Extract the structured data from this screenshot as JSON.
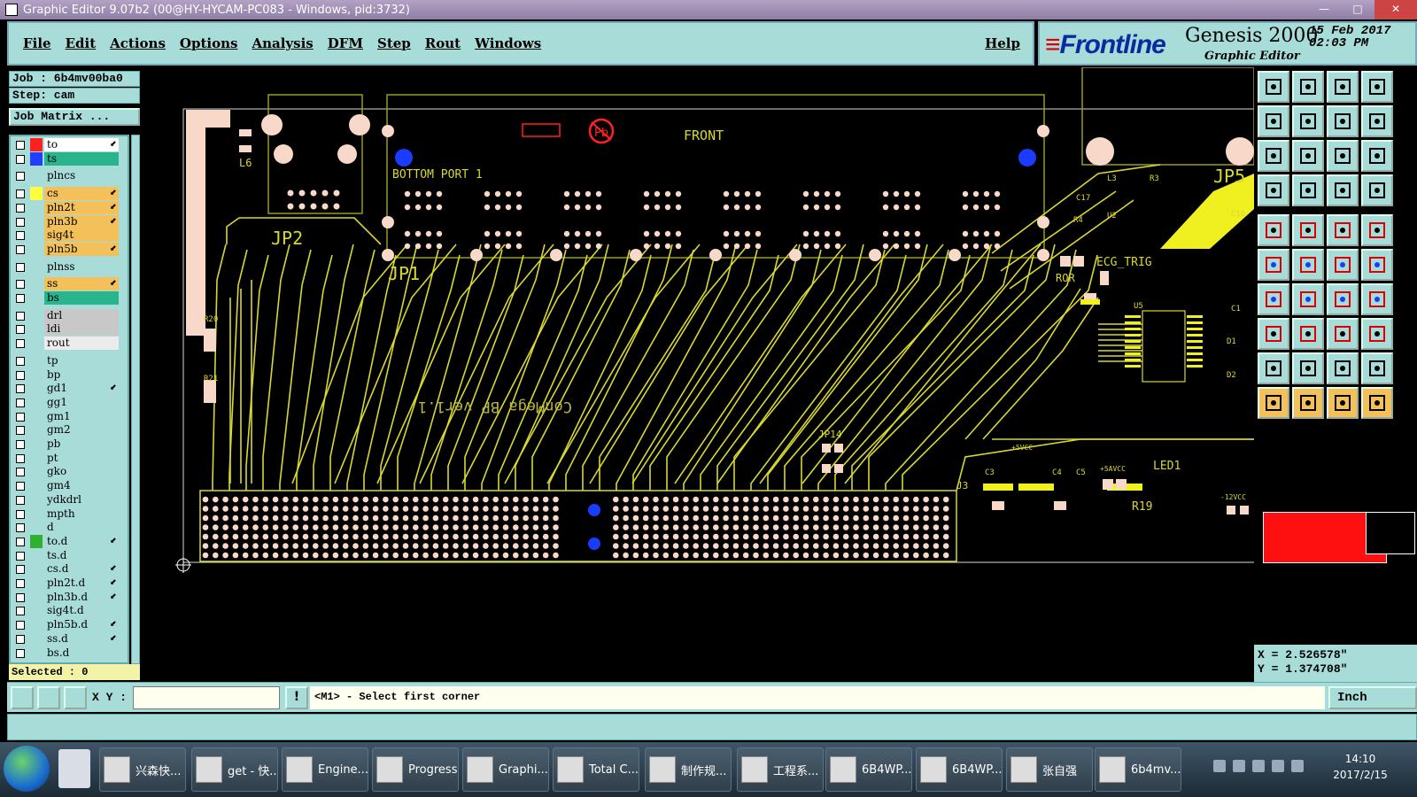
{
  "window": {
    "title": "Graphic Editor 9.07b2 (00@HY-HYCAM-PC083 - Windows, pid:3732)"
  },
  "menu": {
    "items": [
      "File",
      "Edit",
      "Actions",
      "Options",
      "Analysis",
      "DFM",
      "Step",
      "Rout",
      "Windows"
    ],
    "help": "Help"
  },
  "brand": {
    "logo": "Frontline",
    "product": "Genesis 2000",
    "subtitle": "Graphic Editor",
    "date": "15 Feb 2017",
    "time": "02:03 PM"
  },
  "job": {
    "job_label": "Job : 6b4mv00ba0",
    "step_label": "Step: cam",
    "matrix_label": "Job Matrix ..."
  },
  "layers": [
    {
      "name": "to",
      "color": "#ff2020",
      "bg": "#ffffff",
      "arrow": true
    },
    {
      "name": "ts",
      "color": "#2040ff",
      "bg": "#28b48c",
      "arrow": false
    },
    {
      "name": "plncs",
      "color": "",
      "bg": "#a8dcd8",
      "arrow": false
    },
    {
      "name": "cs",
      "color": "#ffff40",
      "bg": "#f3c05a",
      "arrow": true
    },
    {
      "name": "pln2t",
      "color": "",
      "bg": "#f3c05a",
      "arrow": true
    },
    {
      "name": "pln3b",
      "color": "",
      "bg": "#f3c05a",
      "arrow": true
    },
    {
      "name": "sig4t",
      "color": "",
      "bg": "#f3c05a",
      "arrow": false
    },
    {
      "name": "pln5b",
      "color": "",
      "bg": "#f3c05a",
      "arrow": true
    },
    {
      "name": "plnss",
      "color": "",
      "bg": "#a8dcd8",
      "arrow": false
    },
    {
      "name": "ss",
      "color": "",
      "bg": "#f3c05a",
      "arrow": true
    },
    {
      "name": "bs",
      "color": "",
      "bg": "#28b48c",
      "arrow": false
    },
    {
      "name": "drl",
      "color": "",
      "bg": "#c8c8c8",
      "arrow": false
    },
    {
      "name": "ldi",
      "color": "",
      "bg": "#c8c8c8",
      "arrow": false
    },
    {
      "name": "rout",
      "color": "",
      "bg": "#ececec",
      "arrow": false
    },
    {
      "name": "tp",
      "color": "",
      "bg": "#a8dcd8",
      "arrow": false
    },
    {
      "name": "bp",
      "color": "",
      "bg": "#a8dcd8",
      "arrow": false
    },
    {
      "name": "gd1",
      "color": "",
      "bg": "#a8dcd8",
      "arrow": true
    },
    {
      "name": "gg1",
      "color": "",
      "bg": "#a8dcd8",
      "arrow": false
    },
    {
      "name": "gm1",
      "color": "",
      "bg": "#a8dcd8",
      "arrow": false
    },
    {
      "name": "gm2",
      "color": "",
      "bg": "#a8dcd8",
      "arrow": false
    },
    {
      "name": "pb",
      "color": "",
      "bg": "#a8dcd8",
      "arrow": false
    },
    {
      "name": "pt",
      "color": "",
      "bg": "#a8dcd8",
      "arrow": false
    },
    {
      "name": "gko",
      "color": "",
      "bg": "#a8dcd8",
      "arrow": false
    },
    {
      "name": "gm4",
      "color": "",
      "bg": "#a8dcd8",
      "arrow": false
    },
    {
      "name": "ydkdrl",
      "color": "",
      "bg": "#a8dcd8",
      "arrow": false
    },
    {
      "name": "mpth",
      "color": "",
      "bg": "#a8dcd8",
      "arrow": false
    },
    {
      "name": "d",
      "color": "",
      "bg": "#a8dcd8",
      "arrow": false
    },
    {
      "name": "to.d",
      "color": "#30b030",
      "bg": "#a8dcd8",
      "arrow": true
    },
    {
      "name": "ts.d",
      "color": "",
      "bg": "#a8dcd8",
      "arrow": false
    },
    {
      "name": "cs.d",
      "color": "",
      "bg": "#a8dcd8",
      "arrow": true
    },
    {
      "name": "pln2t.d",
      "color": "",
      "bg": "#a8dcd8",
      "arrow": true
    },
    {
      "name": "pln3b.d",
      "color": "",
      "bg": "#a8dcd8",
      "arrow": true
    },
    {
      "name": "sig4t.d",
      "color": "",
      "bg": "#a8dcd8",
      "arrow": false
    },
    {
      "name": "pln5b.d",
      "color": "",
      "bg": "#a8dcd8",
      "arrow": true
    },
    {
      "name": "ss.d",
      "color": "",
      "bg": "#a8dcd8",
      "arrow": true
    },
    {
      "name": "bs.d",
      "color": "",
      "bg": "#a8dcd8",
      "arrow": false
    }
  ],
  "selected": "Selected : 0",
  "board": {
    "labels": [
      "FRONT",
      "BOTTOM PORT 1",
      "JP2",
      "JP1",
      "L6",
      "R20",
      "R21",
      "ECG_TRIG",
      "ROR",
      "U5",
      "U2",
      "C17",
      "R4",
      "R3",
      "L3",
      "C16",
      "JP5",
      "JP14",
      "J3",
      "LED1",
      "R19",
      "C3",
      "C4",
      "C5",
      "+5AVCC",
      "-12VCC",
      "+5VCC",
      "C1",
      "D1",
      "D2"
    ],
    "mirrored_text": "ConMega BP ver1.1"
  },
  "coords": {
    "x": "X = 2.526578\"",
    "y": "Y = 1.374708\""
  },
  "command": {
    "xy_label": "X Y :",
    "input_value": "",
    "prompt": "<M1> - Select first corner",
    "unit": "Inch"
  },
  "taskbar": {
    "items": [
      "兴森快...",
      "get - 快...",
      "Engine...",
      "Progress",
      "Graphi...",
      "Total C...",
      "制作规...",
      "工程系...",
      "6B4WP...",
      "6B4WP...",
      "张自强",
      "6b4mv..."
    ],
    "time": "14:10",
    "date": "2017/2/15"
  }
}
